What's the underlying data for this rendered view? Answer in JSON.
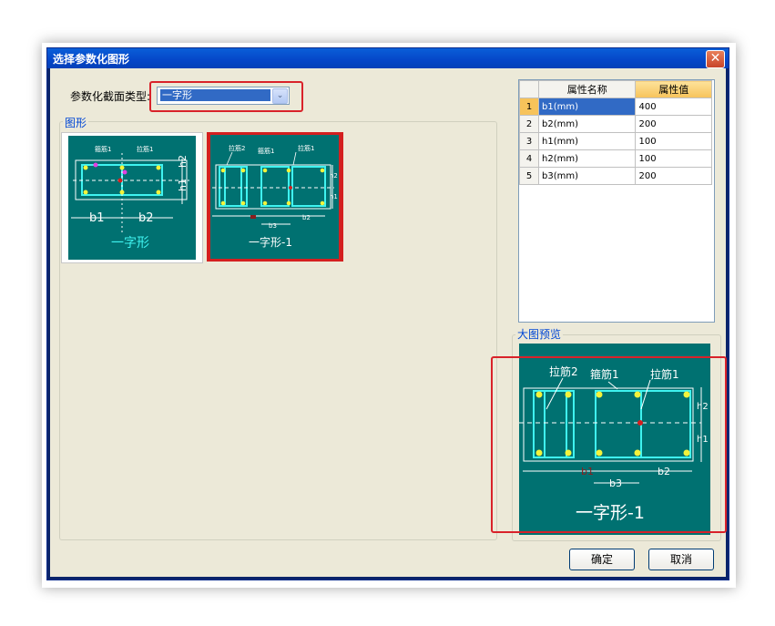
{
  "dialog": {
    "title": "选择参数化图形",
    "close_glyph": "✕"
  },
  "section_type": {
    "label": "参数化截面类型:",
    "selected": "一字形",
    "arrow": "⌄"
  },
  "group_shapes": {
    "label": "图形"
  },
  "shapes": [
    {
      "caption": "一字形",
      "labels": {
        "gujin": "箍筋1",
        "lajin": "拉筋1",
        "b1": "b1",
        "b2": "b2",
        "h1": "h1",
        "h2": "h2"
      }
    },
    {
      "caption": "一字形-1",
      "labels": {
        "lajin2": "拉筋2",
        "gujin": "箍筋1",
        "lajin1": "拉筋1",
        "b1": "b1",
        "b2": "b2",
        "b3": "b3",
        "h1": "h1",
        "h2": "h2"
      }
    }
  ],
  "property_table": {
    "headers": [
      "属性名称",
      "属性值"
    ],
    "rows": [
      {
        "index": "1",
        "name": "b1(mm)",
        "value": "400"
      },
      {
        "index": "2",
        "name": "b2(mm)",
        "value": "200"
      },
      {
        "index": "3",
        "name": "h1(mm)",
        "value": "100"
      },
      {
        "index": "4",
        "name": "h2(mm)",
        "value": "100"
      },
      {
        "index": "5",
        "name": "b3(mm)",
        "value": "200"
      }
    ]
  },
  "group_preview": {
    "label": "大图预览"
  },
  "preview": {
    "caption": "一字形-1",
    "lajin2": "拉筋2",
    "gujin": "箍筋1",
    "lajin1": "拉筋1",
    "b1": "b1",
    "b2": "b2",
    "b3": "b3",
    "h1": "h1",
    "h2": "h2"
  },
  "buttons": {
    "ok": "确定",
    "cancel": "取消"
  },
  "colors": {
    "title_bar": "#0546c8",
    "preview_bg": "#007171",
    "rebar": "#3ff3f0",
    "bar_dot": "#f3f33a",
    "highlight_red": "#d9222a"
  }
}
